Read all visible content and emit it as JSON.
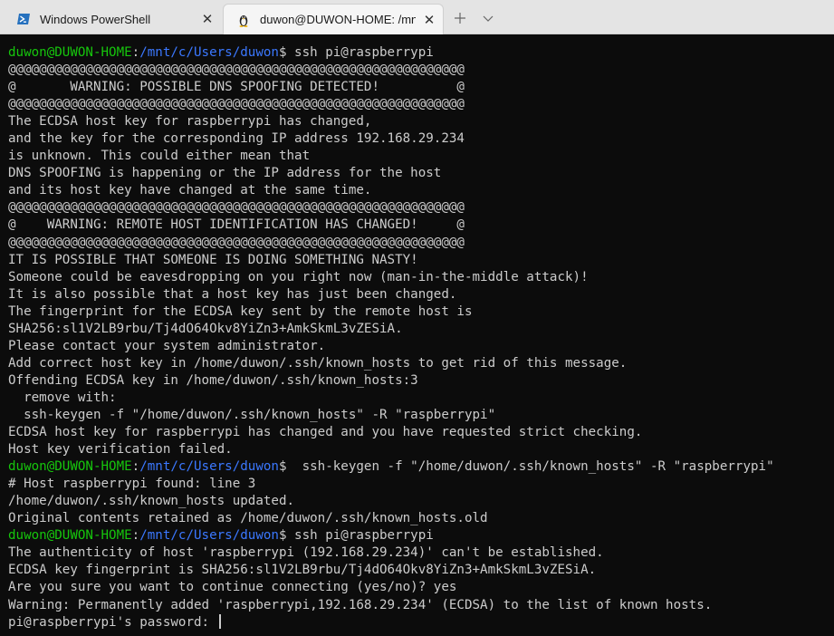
{
  "tabs": [
    {
      "label": "Windows PowerShell",
      "icon": "powershell-icon",
      "active": false
    },
    {
      "label": "duwon@DUWON-HOME: /mnt",
      "icon": "linux-tux-icon",
      "active": true
    }
  ],
  "tab_controls": {
    "close": "✕",
    "new_tab": "+",
    "dropdown": "⌄"
  },
  "terminal": {
    "colors": {
      "background": "#0c0c0c",
      "text": "#cccccc",
      "prompt_user": "#16c60c",
      "prompt_path": "#3b78ff"
    },
    "lines": [
      {
        "user": "duwon@DUWON-HOME",
        "path": "/mnt/c/Users/duwon",
        "cmd": " ssh pi@raspberrypi"
      },
      {
        "text": "@@@@@@@@@@@@@@@@@@@@@@@@@@@@@@@@@@@@@@@@@@@@@@@@@@@@@@@@@@@"
      },
      {
        "text": "@       WARNING: POSSIBLE DNS SPOOFING DETECTED!          @"
      },
      {
        "text": "@@@@@@@@@@@@@@@@@@@@@@@@@@@@@@@@@@@@@@@@@@@@@@@@@@@@@@@@@@@"
      },
      {
        "text": "The ECDSA host key for raspberrypi has changed,"
      },
      {
        "text": "and the key for the corresponding IP address 192.168.29.234"
      },
      {
        "text": "is unknown. This could either mean that"
      },
      {
        "text": "DNS SPOOFING is happening or the IP address for the host"
      },
      {
        "text": "and its host key have changed at the same time."
      },
      {
        "text": "@@@@@@@@@@@@@@@@@@@@@@@@@@@@@@@@@@@@@@@@@@@@@@@@@@@@@@@@@@@"
      },
      {
        "text": "@    WARNING: REMOTE HOST IDENTIFICATION HAS CHANGED!     @"
      },
      {
        "text": "@@@@@@@@@@@@@@@@@@@@@@@@@@@@@@@@@@@@@@@@@@@@@@@@@@@@@@@@@@@"
      },
      {
        "text": "IT IS POSSIBLE THAT SOMEONE IS DOING SOMETHING NASTY!"
      },
      {
        "text": "Someone could be eavesdropping on you right now (man-in-the-middle attack)!"
      },
      {
        "text": "It is also possible that a host key has just been changed."
      },
      {
        "text": "The fingerprint for the ECDSA key sent by the remote host is"
      },
      {
        "text": "SHA256:sl1V2LB9rbu/Tj4dO64Okv8YiZn3+AmkSkmL3vZESiA."
      },
      {
        "text": "Please contact your system administrator."
      },
      {
        "text": "Add correct host key in /home/duwon/.ssh/known_hosts to get rid of this message."
      },
      {
        "text": "Offending ECDSA key in /home/duwon/.ssh/known_hosts:3"
      },
      {
        "text": "  remove with:"
      },
      {
        "text": "  ssh-keygen -f \"/home/duwon/.ssh/known_hosts\" -R \"raspberrypi\""
      },
      {
        "text": "ECDSA host key for raspberrypi has changed and you have requested strict checking."
      },
      {
        "text": "Host key verification failed."
      },
      {
        "user": "duwon@DUWON-HOME",
        "path": "/mnt/c/Users/duwon",
        "cmd": "  ssh-keygen -f \"/home/duwon/.ssh/known_hosts\" -R \"raspberrypi\""
      },
      {
        "text": "# Host raspberrypi found: line 3"
      },
      {
        "text": "/home/duwon/.ssh/known_hosts updated."
      },
      {
        "text": "Original contents retained as /home/duwon/.ssh/known_hosts.old"
      },
      {
        "user": "duwon@DUWON-HOME",
        "path": "/mnt/c/Users/duwon",
        "cmd": " ssh pi@raspberrypi"
      },
      {
        "text": "The authenticity of host 'raspberrypi (192.168.29.234)' can't be established."
      },
      {
        "text": "ECDSA key fingerprint is SHA256:sl1V2LB9rbu/Tj4dO64Okv8YiZn3+AmkSkmL3vZESiA."
      },
      {
        "text": "Are you sure you want to continue connecting (yes/no)? yes"
      },
      {
        "text": "Warning: Permanently added 'raspberrypi,192.168.29.234' (ECDSA) to the list of known hosts."
      },
      {
        "text": "pi@raspberrypi's password: "
      }
    ]
  }
}
